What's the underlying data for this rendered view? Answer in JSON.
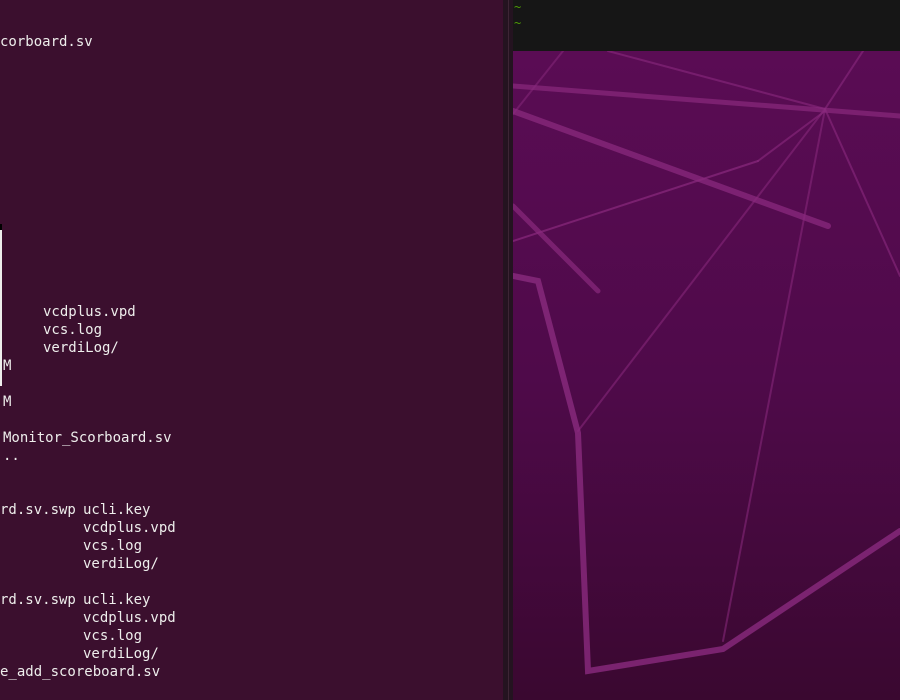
{
  "terminal": {
    "lines": [
      {
        "a": "corboard.sv",
        "b": ""
      },
      {
        "a": "vcdplus.vpd",
        "b": ""
      },
      {
        "a": "vcs.log",
        "b": ""
      },
      {
        "a": "verdiLog/",
        "b": ""
      },
      {
        "a": "M",
        "b": ""
      },
      {
        "a": "M",
        "b": ""
      },
      {
        "a": "Monitor_Scorboard.sv",
        "b": ""
      },
      {
        "a": "..",
        "b": ""
      },
      {
        "a": "rd.sv.swp",
        "b": "ucli.key"
      },
      {
        "a": "",
        "b": "vcdplus.vpd"
      },
      {
        "a": "",
        "b": "vcs.log"
      },
      {
        "a": "",
        "b": "verdiLog/"
      },
      {
        "a": "rd.sv.swp",
        "b": "ucli.key"
      },
      {
        "a": "",
        "b": "vcdplus.vpd"
      },
      {
        "a": "",
        "b": "vcs.log"
      },
      {
        "a": "",
        "b": "verdiLog/"
      },
      {
        "a": "e_add_scoreboard.sv",
        "b": ""
      }
    ]
  },
  "vim": {
    "tilde_1": "~",
    "tilde_2": "~"
  },
  "colors": {
    "terminal_bg": "#3b0f2e",
    "terminal_text": "#eeeeec",
    "vim_bg": "#161616",
    "vim_tilde": "#4e9a06",
    "wallpaper_top": "#5a0c54",
    "wallpaper_bottom": "#3a0830",
    "wallpaper_lines": "#8a2a7e"
  }
}
